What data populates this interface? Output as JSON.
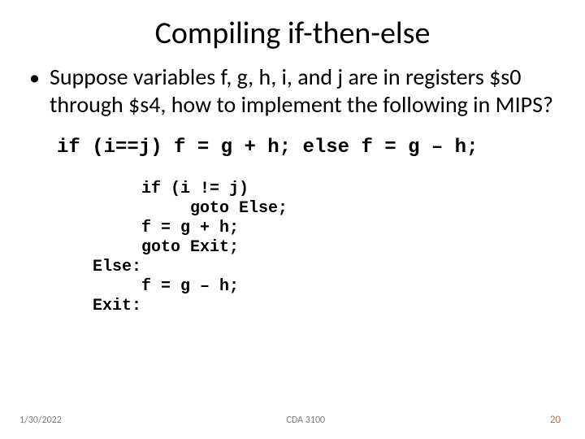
{
  "title": "Compiling if-then-else",
  "bullet": "Suppose variables f, g, h, i, and j are in registers $s0 through $s4, how to implement the following in MIPS?",
  "code_oneline": "if (i==j) f = g + h; else f = g – h;",
  "code_block": "     if (i != j) \n          goto Else;\n     f = g + h;\n     goto Exit;\nElse: \n     f = g – h;\nExit:",
  "footer": {
    "date": "1/30/2022",
    "course": "CDA 3100",
    "page": "20"
  }
}
